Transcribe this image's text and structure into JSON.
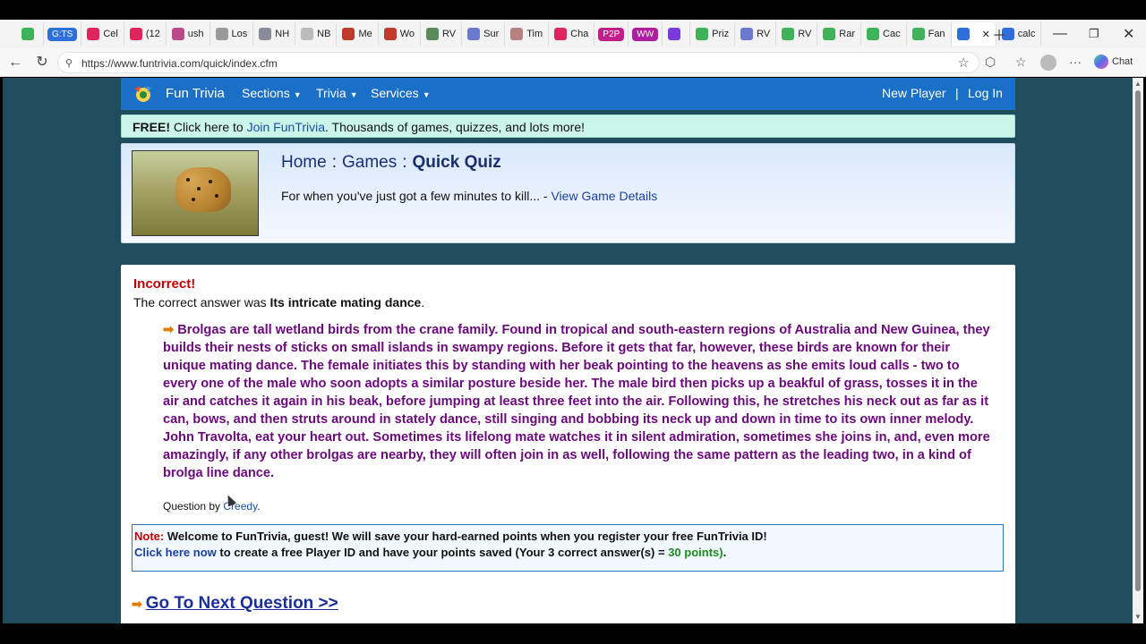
{
  "browser": {
    "tabs": [
      {
        "label": "",
        "color": "#3fb25a"
      },
      {
        "label": "G:TS",
        "color": "#2f6fdc",
        "pill": true
      },
      {
        "label": "Cel",
        "color": "#e0245e"
      },
      {
        "label": "(12",
        "color": "#e0245e"
      },
      {
        "label": "ush",
        "color": "#b84a8a"
      },
      {
        "label": "Los",
        "color": "#999999"
      },
      {
        "label": "NH",
        "color": "#8a8a9a"
      },
      {
        "label": "NB",
        "color": "#bbbbbb"
      },
      {
        "label": "Me",
        "color": "#c0392b"
      },
      {
        "label": "Wo",
        "color": "#c0392b"
      },
      {
        "label": "RV",
        "color": "#5a8a5a"
      },
      {
        "label": "Sur",
        "color": "#6a7ad0"
      },
      {
        "label": "Tim",
        "color": "#b88080"
      },
      {
        "label": "Cha",
        "color": "#e0245e"
      },
      {
        "label": "P2P",
        "color": "#c01e8a",
        "pill": true
      },
      {
        "label": "WW",
        "color": "#b01ea0",
        "pill": true
      },
      {
        "label": "",
        "color": "#7b3ae0"
      },
      {
        "label": "Priz",
        "color": "#3fb25a"
      },
      {
        "label": "RV",
        "color": "#6a7ad0"
      },
      {
        "label": "RV",
        "color": "#3fb25a"
      },
      {
        "label": "Rar",
        "color": "#3fb25a"
      },
      {
        "label": "Cac",
        "color": "#3fb25a"
      },
      {
        "label": "Fan",
        "color": "#3fb25a"
      },
      {
        "label": "",
        "color": "#2f6fdc",
        "active": true
      },
      {
        "label": "calc",
        "color": "#2f6fdc"
      }
    ],
    "url": "https://www.funtrivia.com/quick/index.cfm",
    "chat_label": "Chat"
  },
  "site": {
    "brand": "Fun Trivia",
    "menus": [
      "Sections",
      "Trivia",
      "Services"
    ],
    "new_player": "New Player",
    "divider": "|",
    "login": "Log In"
  },
  "banner": {
    "free": "FREE!",
    "pre": "Click here to",
    "link": "Join FunTrivia",
    "post": ". Thousands of games, quizzes, and lots more!"
  },
  "breadcrumb": {
    "home": "Home",
    "games": "Games",
    "current": "Quick Quiz",
    "sep": ":",
    "tagline": "For when you've just got a few minutes to kill... -",
    "details_link": "View Game Details"
  },
  "result": {
    "status": "Incorrect!",
    "answer_prefix": "The correct answer was",
    "answer": "Its intricate mating dance",
    "answer_suffix": ".",
    "explanation": "Brolgas are tall wetland birds from the crane family. Found in tropical and south-eastern regions of Australia and New Guinea, they builds their nests of sticks on small islands in swampy regions. Before it gets that far, however, these birds are known for their unique mating dance. The female initiates this by standing with her beak pointing to the heavens as she emits loud calls - two to every one of the male who soon adopts a similar posture beside her. The male bird then picks up a beakful of grass, tosses it in the air and catches it again in his beak, before jumping at least three feet into the air. Following this, he stretches his neck out as far as it can, bows, and then struts around in stately dance, still singing and bobbing its neck up and down in time to its own inner melody. John Travolta, eat your heart out. Sometimes its lifelong mate watches it in silent admiration, sometimes she joins in, and, even more amazingly, if any other brolgas are nearby, they will often join in as well, following the same pattern as the leading two, in a kind of brolga line dance.",
    "question_by_prefix": "Question by",
    "author": "Creedy",
    "author_suffix": "."
  },
  "note": {
    "label": "Note:",
    "line1": "Welcome to FunTrivia, guest! We will save your hard-earned points when you register your free FunTrivia ID!",
    "link": "Click here now",
    "line2_mid": "to create a free Player ID and have your points saved (Your 3 correct answer(s) =",
    "points": "30 points)",
    "line2_end": "."
  },
  "next": {
    "label": "Go To Next Question >>"
  }
}
